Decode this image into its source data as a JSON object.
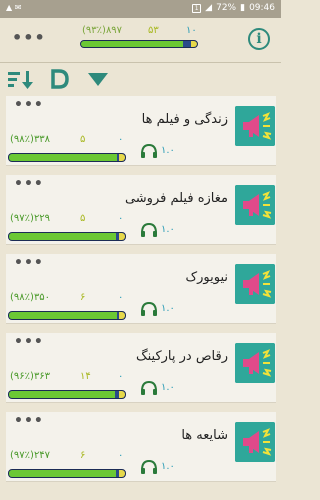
{
  "status": {
    "battery": "72%",
    "time": "09:46",
    "sim": "1"
  },
  "header": {
    "total": {
      "pct": "۸۹۷(۹۳٪)",
      "count": "۵۳",
      "zero": "۱۰",
      "progress": 0.93
    }
  },
  "items": [
    {
      "title": "زندگی و فیلم ها",
      "pct": "۳۳۸(۹۸٪)",
      "count": "۵",
      "zero": "۰",
      "version": "۱.۰",
      "progress": 0.98
    },
    {
      "title": "مغازه فیلم فروشی",
      "pct": "۲۲۹(۹۷٪)",
      "count": "۵",
      "zero": "۰",
      "version": "۱.۰",
      "progress": 0.97
    },
    {
      "title": "نیویورک",
      "pct": "۳۵۰(۹۸٪)",
      "count": "۶",
      "zero": "۰",
      "version": "۱.۰",
      "progress": 0.98
    },
    {
      "title": "رقاص در پارکینگ",
      "pct": "۳۶۳(۹۶٪)",
      "count": "۱۴",
      "zero": "۰",
      "version": "۱.۰",
      "progress": 0.96
    },
    {
      "title": "شایعه ها",
      "pct": "۲۴۷(۹۷٪)",
      "count": "۶",
      "zero": "۰",
      "version": "۱.۰",
      "progress": 0.97
    }
  ],
  "colors": {
    "accent": "#2e8a7c",
    "bar_fill": "#6bc834",
    "bar_track": "#2a4a8a",
    "thumb": "#2fa79a"
  },
  "icons": {
    "menu": "more-dots-icon",
    "info": "info-icon",
    "sort": "sort-icon",
    "filter": "filter-triangle-icon",
    "thumb": "megaphone-icon",
    "audio": "headphones-icon"
  }
}
